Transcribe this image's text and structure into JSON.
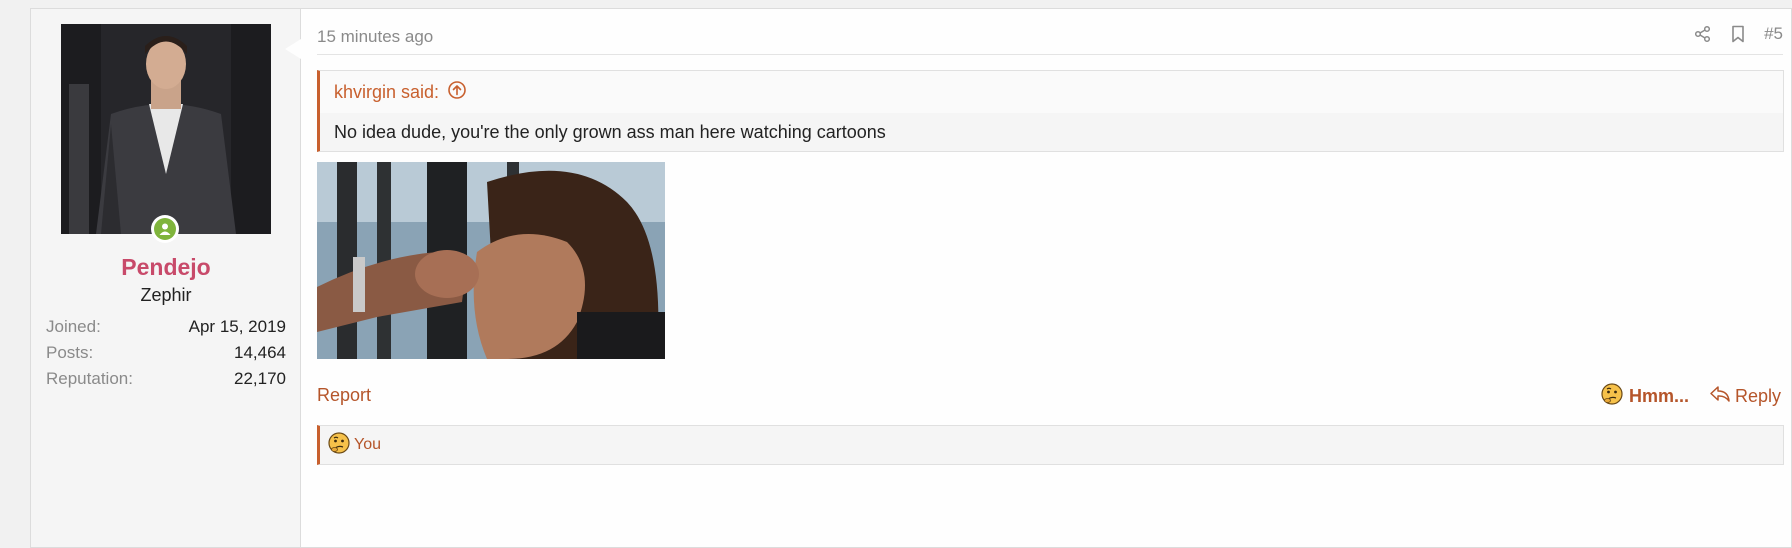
{
  "user": {
    "name": "Pendejo",
    "title": "Zephir",
    "stats": [
      {
        "label": "Joined:",
        "value": "Apr 15, 2019"
      },
      {
        "label": "Posts:",
        "value": "14,464"
      },
      {
        "label": "Reputation:",
        "value": "22,170"
      }
    ]
  },
  "post": {
    "time": "15 minutes ago",
    "number": "#5",
    "quote": {
      "author_line": "khvirgin said:",
      "text": "No idea dude, you're the only grown ass man here watching cartoons"
    },
    "report_label": "Report",
    "reaction_label": "Hmm...",
    "reply_label": "Reply",
    "reactions_summary": "You"
  },
  "icons": {
    "share": "share-icon",
    "bookmark": "bookmark-icon",
    "quote_jump": "arrow-up-circle-icon",
    "reaction": "thinking-face-icon",
    "reply": "reply-arrow-icon"
  },
  "colors": {
    "accent": "#c8602e",
    "username": "#c84a6a",
    "online": "#7fb43c"
  }
}
